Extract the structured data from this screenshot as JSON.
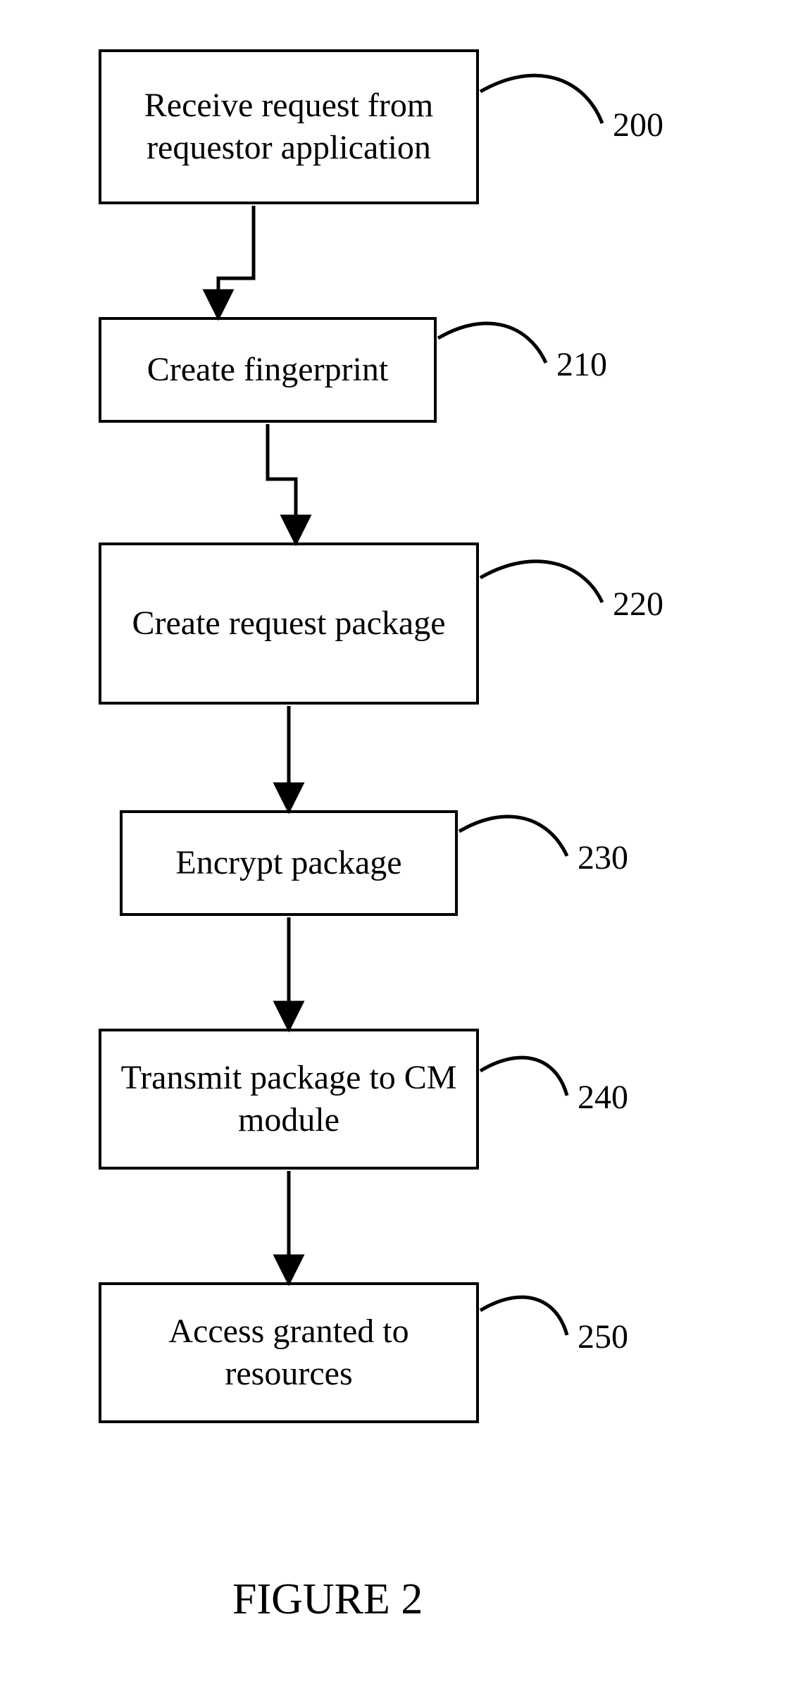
{
  "steps": [
    {
      "id": "200",
      "text": "Receive request from requestor application",
      "ref": "200"
    },
    {
      "id": "210",
      "text": "Create fingerprint",
      "ref": "210"
    },
    {
      "id": "220",
      "text": "Create request package",
      "ref": "220"
    },
    {
      "id": "230",
      "text": "Encrypt package",
      "ref": "230"
    },
    {
      "id": "240",
      "text": "Transmit package to CM module",
      "ref": "240"
    },
    {
      "id": "250",
      "text": "Access granted to resources",
      "ref": "250"
    }
  ],
  "caption": "FIGURE 2"
}
